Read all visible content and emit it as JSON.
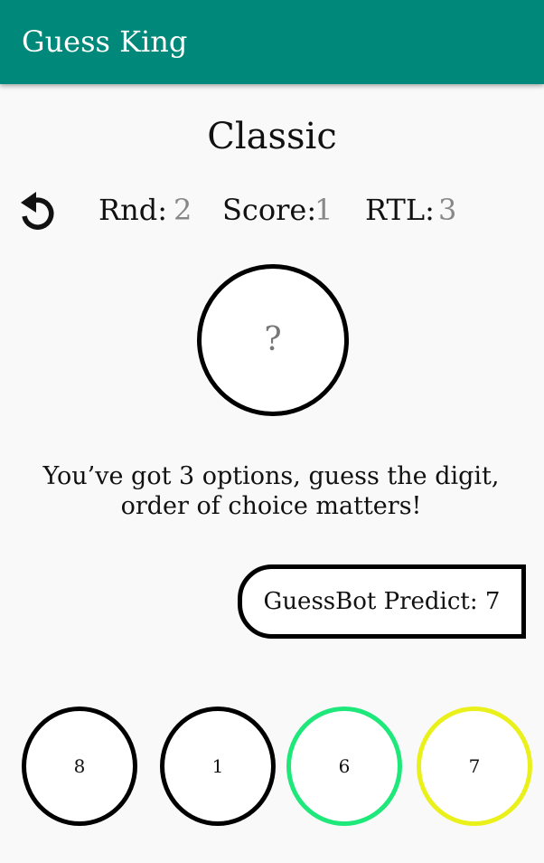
{
  "app_bar": {
    "title": "Guess King",
    "color": "#00887a"
  },
  "game": {
    "mode_title": "Classic",
    "reset_icon": "rotate-left-icon",
    "stats": {
      "round_label": "Rnd:",
      "round_value": "2",
      "score_label": "Score:",
      "score_value": "1",
      "rtl_label": "RTL:",
      "rtl_value": "3"
    },
    "mystery_digit": "?",
    "instructions_line1": "You’ve got 3 options, guess the digit,",
    "instructions_line2": "order of choice matters!",
    "bot_predict_label": "GuessBot Predict: 7"
  },
  "options": [
    {
      "label": "8",
      "border_color": "#000000"
    },
    {
      "label": "1",
      "border_color": "#000000"
    },
    {
      "label": "6",
      "border_color": "#1ee87a"
    },
    {
      "label": "7",
      "border_color": "#eaf11a"
    }
  ]
}
